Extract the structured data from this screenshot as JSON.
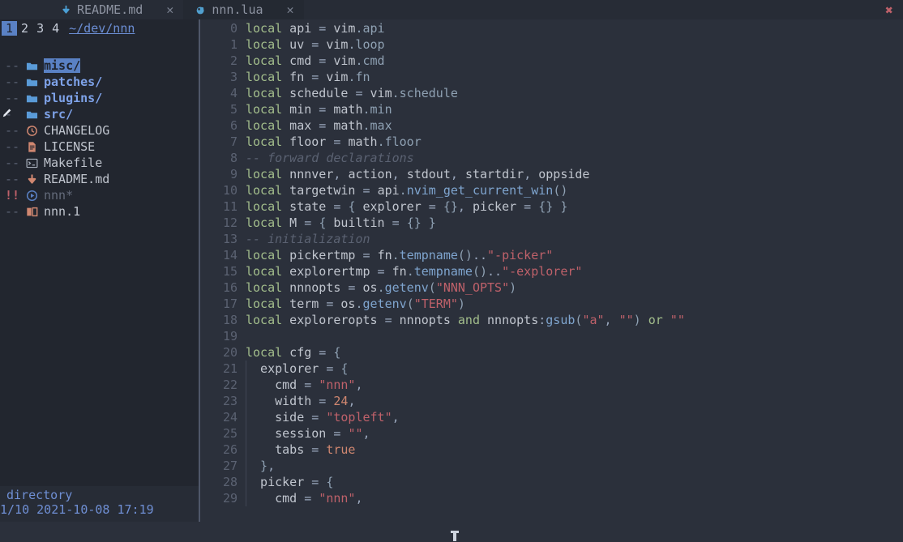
{
  "window": {
    "close_label": "✖"
  },
  "tabline": {
    "tabs": [
      {
        "label": "README.md",
        "icon": "markdown-icon",
        "close": "✕",
        "active": false
      },
      {
        "label": "nnn.lua",
        "icon": "lua-moon-icon",
        "close": "✕",
        "active": true
      }
    ]
  },
  "sidebar": {
    "tab_numbers": [
      "1",
      "2",
      "3",
      "4"
    ],
    "selected_tab_number": "1",
    "cwd": "~/dev/nnn",
    "entries": [
      {
        "status": "--",
        "icon": "folder-icon",
        "name": "misc/",
        "kind": "dir",
        "selected": true
      },
      {
        "status": "--",
        "icon": "folder-icon",
        "name": "patches/",
        "kind": "dir",
        "selected": false
      },
      {
        "status": "--",
        "icon": "folder-icon",
        "name": "plugins/",
        "kind": "dir",
        "selected": false
      },
      {
        "status": "-",
        "icon": "folder-icon",
        "name": "src/",
        "kind": "dir",
        "selected": false,
        "modified": true
      },
      {
        "status": "--",
        "icon": "clock-icon",
        "name": "CHANGELOG",
        "kind": "file",
        "selected": false
      },
      {
        "status": "--",
        "icon": "document-icon",
        "name": "LICENSE",
        "kind": "file",
        "selected": false
      },
      {
        "status": "--",
        "icon": "terminal-icon",
        "name": "Makefile",
        "kind": "file",
        "selected": false
      },
      {
        "status": "--",
        "icon": "markdown-icon",
        "name": "README.md",
        "kind": "file",
        "selected": false
      },
      {
        "status": "!!",
        "icon": "binary-play-icon",
        "name": "nnn*",
        "kind": "exe",
        "selected": false
      },
      {
        "status": "--",
        "icon": "manpage-icon",
        "name": "nnn.1",
        "kind": "file",
        "selected": false
      }
    ],
    "status": {
      "type": "directory",
      "position": "1/10",
      "date": "2021-10-08",
      "time": "17:19"
    }
  },
  "editor": {
    "filename": "nnn.lua",
    "first_line_number": 0,
    "lines": [
      {
        "n": "0",
        "tokens": [
          [
            "k",
            "local"
          ],
          [
            "id",
            " api"
          ],
          [
            "pn",
            " = "
          ],
          [
            "id",
            "vim"
          ],
          [
            "fl",
            ".api"
          ]
        ]
      },
      {
        "n": "1",
        "tokens": [
          [
            "k",
            "local"
          ],
          [
            "id",
            " uv"
          ],
          [
            "pn",
            " = "
          ],
          [
            "id",
            "vim"
          ],
          [
            "fl",
            ".loop"
          ]
        ]
      },
      {
        "n": "2",
        "tokens": [
          [
            "k",
            "local"
          ],
          [
            "id",
            " cmd"
          ],
          [
            "pn",
            " = "
          ],
          [
            "id",
            "vim"
          ],
          [
            "fl",
            ".cmd"
          ]
        ]
      },
      {
        "n": "3",
        "tokens": [
          [
            "k",
            "local"
          ],
          [
            "id",
            " fn"
          ],
          [
            "pn",
            " = "
          ],
          [
            "id",
            "vim"
          ],
          [
            "fl",
            ".fn"
          ]
        ]
      },
      {
        "n": "4",
        "tokens": [
          [
            "k",
            "local"
          ],
          [
            "id",
            " schedule"
          ],
          [
            "pn",
            " = "
          ],
          [
            "id",
            "vim"
          ],
          [
            "fl",
            ".schedule"
          ]
        ]
      },
      {
        "n": "5",
        "tokens": [
          [
            "k",
            "local"
          ],
          [
            "id",
            " min"
          ],
          [
            "pn",
            " = "
          ],
          [
            "id",
            "math"
          ],
          [
            "fl",
            ".min"
          ]
        ]
      },
      {
        "n": "6",
        "tokens": [
          [
            "k",
            "local"
          ],
          [
            "id",
            " max"
          ],
          [
            "pn",
            " = "
          ],
          [
            "id",
            "math"
          ],
          [
            "fl",
            ".max"
          ]
        ]
      },
      {
        "n": "7",
        "tokens": [
          [
            "k",
            "local"
          ],
          [
            "id",
            " floor"
          ],
          [
            "pn",
            " = "
          ],
          [
            "id",
            "math"
          ],
          [
            "fl",
            ".floor"
          ]
        ]
      },
      {
        "n": "8",
        "tokens": [
          [
            "cm",
            "-- forward declarations"
          ]
        ]
      },
      {
        "n": "9",
        "tokens": [
          [
            "k",
            "local"
          ],
          [
            "id",
            " nnnver"
          ],
          [
            "pn",
            ", "
          ],
          [
            "id",
            "action"
          ],
          [
            "pn",
            ", "
          ],
          [
            "id",
            "stdout"
          ],
          [
            "pn",
            ", "
          ],
          [
            "id",
            "startdir"
          ],
          [
            "pn",
            ", "
          ],
          [
            "id",
            "oppside"
          ]
        ]
      },
      {
        "n": "10",
        "tokens": [
          [
            "k",
            "local"
          ],
          [
            "id",
            " targetwin"
          ],
          [
            "pn",
            " = "
          ],
          [
            "id",
            "api"
          ],
          [
            "fl",
            "."
          ],
          [
            "fn",
            "nvim_get_current_win"
          ],
          [
            "br",
            "()"
          ]
        ]
      },
      {
        "n": "11",
        "tokens": [
          [
            "k",
            "local"
          ],
          [
            "id",
            " state"
          ],
          [
            "pn",
            " = "
          ],
          [
            "br",
            "{ "
          ],
          [
            "id",
            "explorer"
          ],
          [
            "pn",
            " = "
          ],
          [
            "br",
            "{}"
          ],
          [
            "pn",
            ", "
          ],
          [
            "id",
            "picker"
          ],
          [
            "pn",
            " = "
          ],
          [
            "br",
            "{} }"
          ]
        ]
      },
      {
        "n": "12",
        "tokens": [
          [
            "k",
            "local"
          ],
          [
            "id",
            " M"
          ],
          [
            "pn",
            " = "
          ],
          [
            "br",
            "{ "
          ],
          [
            "id",
            "builtin"
          ],
          [
            "pn",
            " = "
          ],
          [
            "br",
            "{} }"
          ]
        ]
      },
      {
        "n": "13",
        "tokens": [
          [
            "cm",
            "-- initialization"
          ]
        ]
      },
      {
        "n": "14",
        "tokens": [
          [
            "k",
            "local"
          ],
          [
            "id",
            " pickertmp"
          ],
          [
            "pn",
            " = "
          ],
          [
            "id",
            "fn"
          ],
          [
            "fl",
            "."
          ],
          [
            "fn",
            "tempname"
          ],
          [
            "br",
            "()"
          ],
          [
            "pn",
            ".."
          ],
          [
            "st",
            "\"-picker\""
          ]
        ]
      },
      {
        "n": "15",
        "tokens": [
          [
            "k",
            "local"
          ],
          [
            "id",
            " explorertmp"
          ],
          [
            "pn",
            " = "
          ],
          [
            "id",
            "fn"
          ],
          [
            "fl",
            "."
          ],
          [
            "fn",
            "tempname"
          ],
          [
            "br",
            "()"
          ],
          [
            "pn",
            ".."
          ],
          [
            "st",
            "\"-explorer\""
          ]
        ]
      },
      {
        "n": "16",
        "tokens": [
          [
            "k",
            "local"
          ],
          [
            "id",
            " nnnopts"
          ],
          [
            "pn",
            " = "
          ],
          [
            "id",
            "os"
          ],
          [
            "fl",
            "."
          ],
          [
            "fn",
            "getenv"
          ],
          [
            "br",
            "("
          ],
          [
            "st",
            "\"NNN_OPTS\""
          ],
          [
            "br",
            ")"
          ]
        ]
      },
      {
        "n": "17",
        "tokens": [
          [
            "k",
            "local"
          ],
          [
            "id",
            " term"
          ],
          [
            "pn",
            " = "
          ],
          [
            "id",
            "os"
          ],
          [
            "fl",
            "."
          ],
          [
            "fn",
            "getenv"
          ],
          [
            "br",
            "("
          ],
          [
            "st",
            "\"TERM\""
          ],
          [
            "br",
            ")"
          ]
        ]
      },
      {
        "n": "18",
        "tokens": [
          [
            "k",
            "local"
          ],
          [
            "id",
            " exploreropts"
          ],
          [
            "pn",
            " = "
          ],
          [
            "id",
            "nnnopts"
          ],
          [
            "k",
            " and"
          ],
          [
            "id",
            " nnnopts"
          ],
          [
            "pn",
            ":"
          ],
          [
            "fn",
            "gsub"
          ],
          [
            "br",
            "("
          ],
          [
            "st",
            "\"a\""
          ],
          [
            "pn",
            ", "
          ],
          [
            "st",
            "\"\""
          ],
          [
            "br",
            ")"
          ],
          [
            "k",
            " or"
          ],
          [
            "st",
            " \"\""
          ]
        ]
      },
      {
        "n": "19",
        "tokens": []
      },
      {
        "n": "20",
        "tokens": [
          [
            "k",
            "local"
          ],
          [
            "id",
            " cfg"
          ],
          [
            "pn",
            " = "
          ],
          [
            "br",
            "{"
          ]
        ]
      },
      {
        "n": "21",
        "tokens": [
          [
            "id",
            "  explorer"
          ],
          [
            "pn",
            " = "
          ],
          [
            "br",
            "{"
          ]
        ]
      },
      {
        "n": "22",
        "tokens": [
          [
            "id",
            "    cmd"
          ],
          [
            "pn",
            " = "
          ],
          [
            "st",
            "\"nnn\""
          ],
          [
            "pn",
            ","
          ]
        ]
      },
      {
        "n": "23",
        "tokens": [
          [
            "id",
            "    width"
          ],
          [
            "pn",
            " = "
          ],
          [
            "nu",
            "24"
          ],
          [
            "pn",
            ","
          ]
        ]
      },
      {
        "n": "24",
        "tokens": [
          [
            "id",
            "    side"
          ],
          [
            "pn",
            " = "
          ],
          [
            "st",
            "\"topleft\""
          ],
          [
            "pn",
            ","
          ]
        ]
      },
      {
        "n": "25",
        "tokens": [
          [
            "id",
            "    session"
          ],
          [
            "pn",
            " = "
          ],
          [
            "st",
            "\"\""
          ],
          [
            "pn",
            ","
          ]
        ]
      },
      {
        "n": "26",
        "tokens": [
          [
            "id",
            "    tabs"
          ],
          [
            "pn",
            " = "
          ],
          [
            "nu",
            "true"
          ]
        ]
      },
      {
        "n": "27",
        "tokens": [
          [
            "br",
            "  }"
          ],
          [
            "pn",
            ","
          ]
        ]
      },
      {
        "n": "28",
        "tokens": [
          [
            "id",
            "  picker"
          ],
          [
            "pn",
            " = "
          ],
          [
            "br",
            "{"
          ]
        ]
      },
      {
        "n": "29",
        "tokens": [
          [
            "id",
            "    cmd"
          ],
          [
            "pn",
            " = "
          ],
          [
            "st",
            "\"nnn\""
          ],
          [
            "pn",
            ","
          ]
        ]
      }
    ]
  },
  "colors": {
    "bg_editor": "#2b303b",
    "bg_sidebar": "#22262f",
    "bg_tabline": "#272c36",
    "accent_blue": "#5a81c4",
    "keyword_green": "#a3be8c",
    "string_red": "#bf616a",
    "number_orange": "#d08770",
    "comment_gray": "#5b6272",
    "dir_blue": "#7ea2e8"
  }
}
